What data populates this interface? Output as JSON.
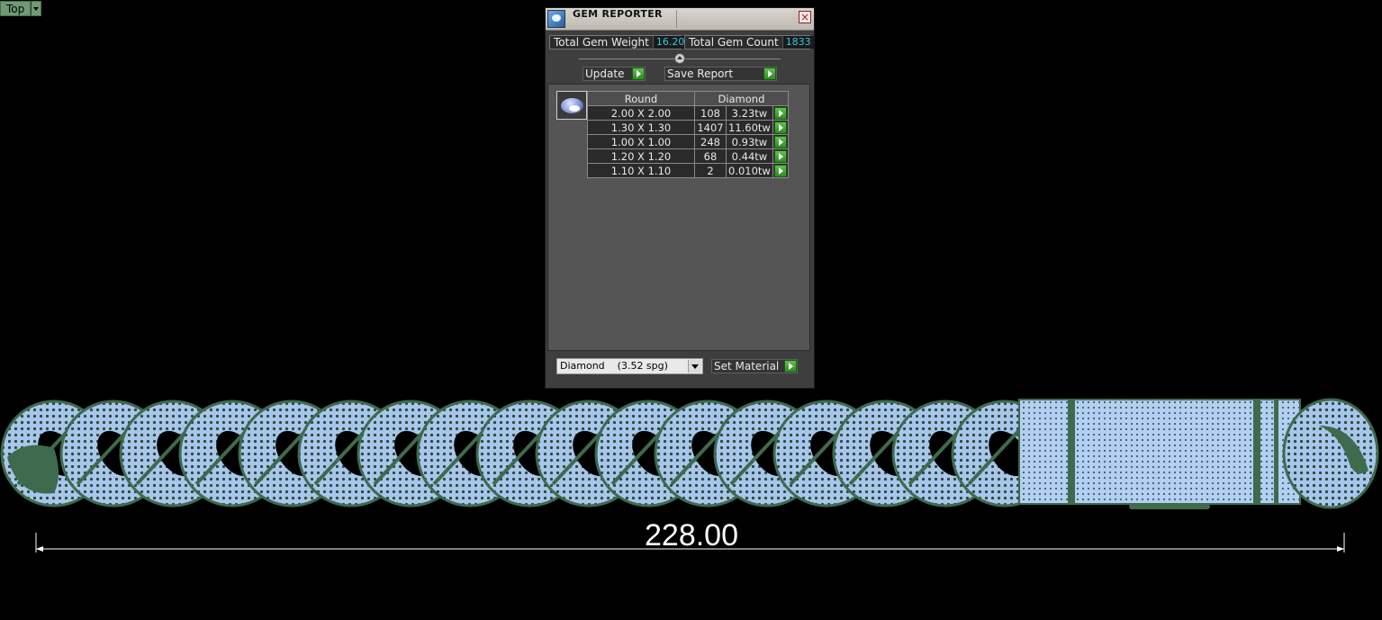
{
  "viewport": {
    "label": "Top"
  },
  "panel": {
    "title": "GEM REPORTER",
    "total_weight_label": "Total Gem Weight",
    "total_weight_value": "16.20",
    "total_count_label": "Total Gem Count",
    "total_count_value": "1833",
    "update_label": "Update",
    "save_report_label": "Save Report",
    "table": {
      "headers": [
        "Round",
        "Diamond"
      ],
      "rows": [
        {
          "size": "2.00 X 2.00",
          "count": "108",
          "weight": "3.23tw"
        },
        {
          "size": "1.30 X 1.30",
          "count": "1407",
          "weight": "11.60tw"
        },
        {
          "size": "1.00 X 1.00",
          "count": "248",
          "weight": "0.93tw"
        },
        {
          "size": "1.20 X 1.20",
          "count": "68",
          "weight": "0.44tw"
        },
        {
          "size": "1.10 X 1.10",
          "count": "2",
          "weight": "0.010tw"
        }
      ]
    },
    "material_value": "Diamond    (3.52 spg)",
    "set_material_label": "Set Material"
  },
  "dimension": {
    "value": "228.00"
  },
  "colors": {
    "stat_value": "#38c6e8",
    "go_button": "#3aa32c",
    "gem_fill": "#a9c7ee",
    "metal": "#3e6a4d"
  },
  "icons": [
    "app-icon",
    "close-icon",
    "gem-shape-icon",
    "arrow-right-icon",
    "dropdown-arrow-icon"
  ]
}
